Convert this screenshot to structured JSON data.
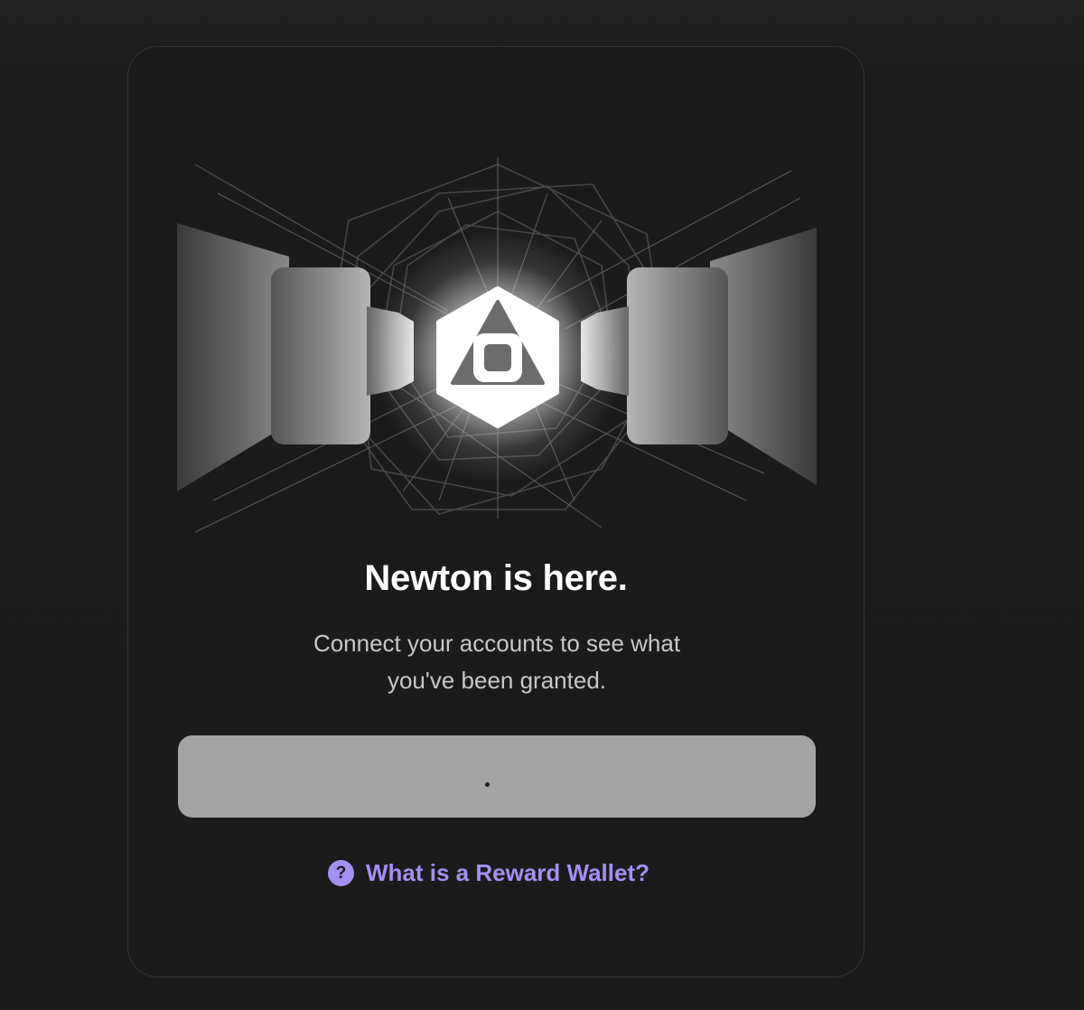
{
  "hero": {
    "logo_icon": "newton-hexagon-logo"
  },
  "title": "Newton is here.",
  "subtitle_line1": "Connect your accounts to see what",
  "subtitle_line2": "you've been granted.",
  "connect_button": {
    "state": "loading",
    "loading_indicator": "•"
  },
  "help_link": {
    "icon": "question-circle-icon",
    "icon_glyph": "?",
    "label": "What is a Reward Wallet?"
  },
  "colors": {
    "background": "#1b1b1c",
    "card_border": "#343436",
    "button_bg": "#a3a3a3",
    "link_accent": "#a48ff3",
    "title": "#ffffff",
    "subtitle": "#c8c8c8"
  }
}
